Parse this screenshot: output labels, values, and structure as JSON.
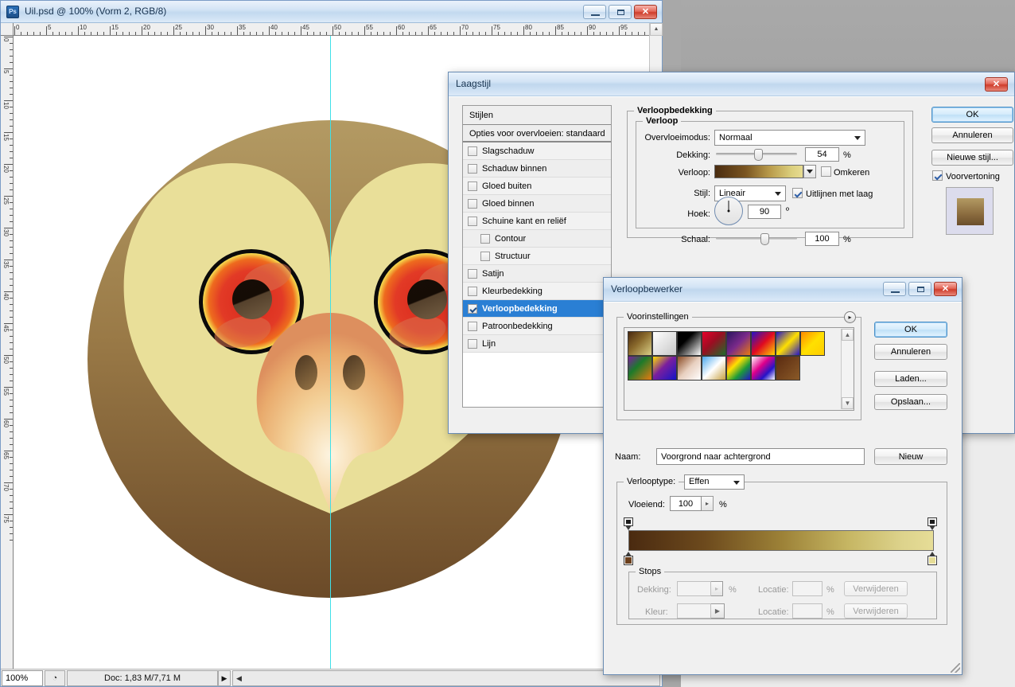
{
  "document_window": {
    "title": "Uil.psd @ 100% (Vorm 2, RGB/8)",
    "app_icon": "photoshop-icon",
    "minimize_label": "",
    "maximize_label": "",
    "close_label": "✕",
    "ruler_h_labels": [
      "0",
      "5",
      "10",
      "15",
      "20",
      "25",
      "30",
      "35",
      "40",
      "45",
      "50",
      "55",
      "60",
      "65",
      "70",
      "75",
      "80",
      "85",
      "90",
      "95"
    ],
    "ruler_v_labels": [
      "0",
      "5",
      "10",
      "15",
      "20",
      "25",
      "30",
      "35",
      "40",
      "45",
      "50",
      "55",
      "60",
      "65",
      "70",
      "75"
    ],
    "statusbar": {
      "zoom": "100%",
      "preview_icon": "pie-clock-icon",
      "doc_info": "Doc: 1,83 M/7,71 M",
      "expand_arrow": "▶",
      "scroll_left_arrow": "◀"
    }
  },
  "layer_style_dialog": {
    "title": "Laagstijl",
    "close_label": "✕",
    "styles_panel": {
      "header": "Stijlen",
      "blending_options": "Opties voor overvloeien: standaard",
      "items": [
        {
          "label": "Slagschaduw",
          "checked": false,
          "indent": false,
          "selected": false
        },
        {
          "label": "Schaduw binnen",
          "checked": false,
          "indent": false,
          "selected": false
        },
        {
          "label": "Gloed buiten",
          "checked": false,
          "indent": false,
          "selected": false
        },
        {
          "label": "Gloed binnen",
          "checked": false,
          "indent": false,
          "selected": false
        },
        {
          "label": "Schuine kant en reliëf",
          "checked": false,
          "indent": false,
          "selected": false
        },
        {
          "label": "Contour",
          "checked": false,
          "indent": true,
          "selected": false
        },
        {
          "label": "Structuur",
          "checked": false,
          "indent": true,
          "selected": false
        },
        {
          "label": "Satijn",
          "checked": false,
          "indent": false,
          "selected": false
        },
        {
          "label": "Kleurbedekking",
          "checked": false,
          "indent": false,
          "selected": false
        },
        {
          "label": "Verloopbedekking",
          "checked": true,
          "indent": false,
          "selected": true
        },
        {
          "label": "Patroonbedekking",
          "checked": false,
          "indent": false,
          "selected": false
        },
        {
          "label": "Lijn",
          "checked": false,
          "indent": false,
          "selected": false
        }
      ]
    },
    "gradient_overlay": {
      "section_title": "Verloopbedekking",
      "group_title": "Verloop",
      "blend_mode_label": "Overvloeimodus:",
      "blend_mode_value": "Normaal",
      "opacity_label": "Dekking:",
      "opacity_value": "54",
      "opacity_unit": "%",
      "gradient_label": "Verloop:",
      "reverse_label": "Omkeren",
      "reverse_checked": false,
      "style_label": "Stijl:",
      "style_value": "Lineair",
      "align_label": "Uitlijnen met laag",
      "align_checked": true,
      "angle_label": "Hoek:",
      "angle_value": "90",
      "angle_unit": "º",
      "scale_label": "Schaal:",
      "scale_value": "100",
      "scale_unit": "%"
    },
    "buttons": {
      "ok": "OK",
      "cancel": "Annuleren",
      "new_style": "Nieuwe stijl...",
      "preview_label": "Voorvertoning",
      "preview_checked": true
    }
  },
  "gradient_editor_dialog": {
    "title": "Verloopbewerker",
    "minimize_label": "",
    "maximize_label": "",
    "close_label": "✕",
    "presets": {
      "legend": "Voorinstellingen",
      "menu_icon": "preset-menu-icon",
      "scroll_up_icon": "▲",
      "scroll_down_icon": "▼",
      "swatches": [
        "linear-gradient(135deg,#4a2a10 0%,#8a6a2c 45%,#d9cf86 100%)",
        "linear-gradient(135deg,#ffffff 0%,#c8c8c8 100%)",
        "linear-gradient(135deg,#000000 0%,#000000 35%,#ffffff 100%)",
        "linear-gradient(135deg,#e8002a 0%,#9a0e22 45%,#1f6b2a 100%)",
        "linear-gradient(135deg,#2b1560 0%,#7a2a8a 50%,#e87a10 100%)",
        "linear-gradient(135deg,#2414c8 0%,#e00a20 50%,#ffd400 100%)",
        "linear-gradient(135deg,#2414c8 0%,#ffe000 50%,#2414c8 100%)",
        "linear-gradient(135deg,#ff8a00 0%,#ffe000 50%,#ffcc00 100%)",
        "linear-gradient(135deg,#7a1f9e 0%,#1c7a2a 40%,#e87a10 100%)",
        "linear-gradient(135deg,#ffe000 0%,#7a1f9e 45%,#1414c8 100%)",
        "linear-gradient(135deg,#8a4a24 0%,#e8d0c0 50%,#ffffff 100%)",
        "linear-gradient(135deg,#4aa8ee 0%,#ffffff 50%,#c8a040 100%)",
        "linear-gradient(135deg,#e00a50 0%,#ffe000 35%,#1c9a3a 65%,#2414c8 100%)",
        "linear-gradient(135deg,#ffffff 0%,#e0008a 40%,#2414c8 70%,#ffffff 100%)",
        "linear-gradient(135deg,#5a2a10 0%,#8a5a28 100%)"
      ]
    },
    "name_label": "Naam:",
    "name_value": "Voorgrond naar achtergrond",
    "new_button": "Nieuw",
    "gradient_type": {
      "legend": "Verlooptype:",
      "value": "Effen",
      "smoothness_label": "Vloeiend:",
      "smoothness_value": "100",
      "smoothness_unit": "%"
    },
    "gradient_bar": {
      "start_color": "#4a2a10",
      "end_color": "#e6dd97"
    },
    "stops": {
      "legend": "Stops",
      "opacity_label": "Dekking:",
      "opacity_value": "",
      "opacity_unit": "%",
      "opacity_location_label": "Locatie:",
      "opacity_location_value": "",
      "opacity_location_unit": "%",
      "opacity_delete": "Verwijderen",
      "color_label": "Kleur:",
      "color_value": "",
      "color_location_label": "Locatie:",
      "color_location_value": "",
      "color_location_unit": "%",
      "color_delete": "Verwijderen"
    },
    "buttons": {
      "ok": "OK",
      "cancel": "Annuleren",
      "load": "Laden...",
      "save": "Opslaan..."
    }
  },
  "colors": {
    "accent_blue": "#2a7fd4",
    "owl_body_top": "#b5975f",
    "owl_body_bottom": "#6d4a29",
    "owl_face": "#e6dd97",
    "eye_red": "#e23226",
    "beak": "#f0c389"
  }
}
